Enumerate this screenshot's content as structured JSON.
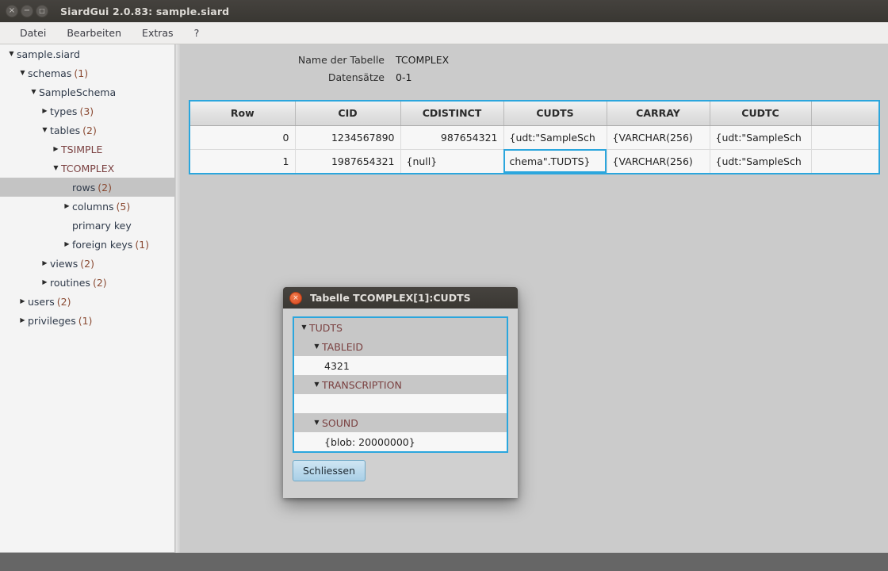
{
  "window": {
    "title": "SiardGui 2.0.83: sample.siard",
    "buttons": [
      {
        "name": "close",
        "glyph": "×"
      },
      {
        "name": "minimize",
        "glyph": "−"
      },
      {
        "name": "maximize",
        "glyph": "□"
      }
    ]
  },
  "menubar": {
    "items": [
      "Datei",
      "Bearbeiten",
      "Extras",
      "?"
    ]
  },
  "sidebar": {
    "items": [
      {
        "label": "sample.siard",
        "count": "",
        "indent": 0,
        "arrow": "▼",
        "selected": false,
        "kind": "node"
      },
      {
        "label": "schemas",
        "count": "(1)",
        "indent": 1,
        "arrow": "▼",
        "selected": false,
        "kind": "node"
      },
      {
        "label": "SampleSchema",
        "count": "",
        "indent": 2,
        "arrow": "▼",
        "selected": false,
        "kind": "node"
      },
      {
        "label": "types",
        "count": "(3)",
        "indent": 3,
        "arrow": "▶",
        "selected": false,
        "kind": "node"
      },
      {
        "label": "tables",
        "count": "(2)",
        "indent": 3,
        "arrow": "▼",
        "selected": false,
        "kind": "node"
      },
      {
        "label": "TSIMPLE",
        "count": "",
        "indent": 4,
        "arrow": "▶",
        "selected": false,
        "kind": "table"
      },
      {
        "label": "TCOMPLEX",
        "count": "",
        "indent": 4,
        "arrow": "▼",
        "selected": false,
        "kind": "table"
      },
      {
        "label": "rows",
        "count": "(2)",
        "indent": 5,
        "arrow": "",
        "selected": true,
        "kind": "node"
      },
      {
        "label": "columns",
        "count": "(5)",
        "indent": 5,
        "arrow": "▶",
        "selected": false,
        "kind": "node"
      },
      {
        "label": "primary key",
        "count": "",
        "indent": 5,
        "arrow": "",
        "selected": false,
        "kind": "node"
      },
      {
        "label": "foreign keys",
        "count": "(1)",
        "indent": 5,
        "arrow": "▶",
        "selected": false,
        "kind": "node"
      },
      {
        "label": "views",
        "count": "(2)",
        "indent": 3,
        "arrow": "▶",
        "selected": false,
        "kind": "node"
      },
      {
        "label": "routines",
        "count": "(2)",
        "indent": 3,
        "arrow": "▶",
        "selected": false,
        "kind": "node"
      },
      {
        "label": "users",
        "count": "(2)",
        "indent": 1,
        "arrow": "▶",
        "selected": false,
        "kind": "node"
      },
      {
        "label": "privileges",
        "count": "(1)",
        "indent": 1,
        "arrow": "▶",
        "selected": false,
        "kind": "node"
      }
    ]
  },
  "main": {
    "info": [
      {
        "label": "Name der Tabelle",
        "value": "TCOMPLEX"
      },
      {
        "label": "Datensätze",
        "value": "0-1"
      }
    ],
    "table": {
      "columns": [
        "Row",
        "CID",
        "CDISTINCT",
        "CUDTS",
        "CARRAY",
        "CUDTC",
        ""
      ],
      "rows": [
        {
          "row": "0",
          "cells": [
            {
              "value": "1234567890",
              "align": "num",
              "selected": false
            },
            {
              "value": "987654321",
              "align": "num",
              "selected": false
            },
            {
              "value": "{udt:\"SampleSch",
              "align": "txt",
              "selected": false
            },
            {
              "value": "{VARCHAR(256)",
              "align": "txt",
              "selected": false
            },
            {
              "value": "{udt:\"SampleSch",
              "align": "txt",
              "selected": false
            },
            {
              "value": "",
              "align": "txt",
              "selected": false
            }
          ]
        },
        {
          "row": "1",
          "cells": [
            {
              "value": "1987654321",
              "align": "num",
              "selected": false
            },
            {
              "value": "{null}",
              "align": "txt",
              "selected": false
            },
            {
              "value": "chema\".TUDTS}",
              "align": "txt",
              "selected": true
            },
            {
              "value": "{VARCHAR(256)",
              "align": "txt",
              "selected": false
            },
            {
              "value": "{udt:\"SampleSch",
              "align": "txt",
              "selected": false
            },
            {
              "value": "",
              "align": "txt",
              "selected": false
            }
          ]
        }
      ]
    }
  },
  "dialog": {
    "title": "Tabelle TCOMPLEX[1]:CUDTS",
    "close_glyph": "×",
    "tree": [
      {
        "type": "node",
        "label": "TUDTS",
        "arrow": "▼",
        "indent": 0
      },
      {
        "type": "node",
        "label": "TABLEID",
        "arrow": "▼",
        "indent": 1
      },
      {
        "type": "value",
        "label": "4321",
        "arrow": "",
        "indent": 2
      },
      {
        "type": "node",
        "label": "TRANSCRIPTION",
        "arrow": "▼",
        "indent": 1
      },
      {
        "type": "value",
        "label": "",
        "arrow": "",
        "indent": 2
      },
      {
        "type": "node",
        "label": "SOUND",
        "arrow": "▼",
        "indent": 1
      },
      {
        "type": "value",
        "label": "{blob: 20000000}",
        "arrow": "",
        "indent": 2
      }
    ],
    "close_button": "Schliessen"
  },
  "colors": {
    "accent": "#2ba6dd",
    "titlebar": "#3c3a35",
    "dialog_close": "#d9471f",
    "selection": "#c4c4c4"
  }
}
